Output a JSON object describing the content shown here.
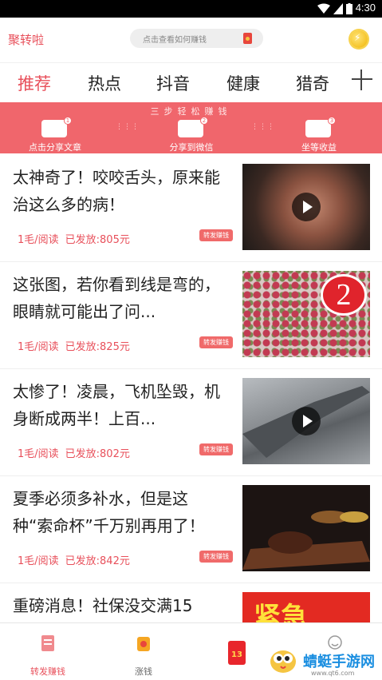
{
  "status_bar": {
    "time": "4:30"
  },
  "header": {
    "brand": "聚转啦",
    "search_placeholder": "点击查看如何赚钱"
  },
  "tabs": [
    {
      "label": "推荐",
      "active": true
    },
    {
      "label": "热点",
      "active": false
    },
    {
      "label": "抖音",
      "active": false
    },
    {
      "label": "健康",
      "active": false
    },
    {
      "label": "猎奇",
      "active": false
    }
  ],
  "banner": {
    "title": "三步轻松赚钱",
    "steps": [
      {
        "num": "1",
        "label": "点击分享文章"
      },
      {
        "num": "2",
        "label": "分享到微信"
      },
      {
        "num": "3",
        "label": "坐等收益"
      }
    ]
  },
  "articles": [
    {
      "title": "太神奇了！咬咬舌头，原来能治这么多的病！",
      "rate": "1毛/阅读",
      "paid": "已发放:805元",
      "tag": "转发赚钱",
      "video": true
    },
    {
      "title": "这张图，若你看到线是弯的，眼睛就可能出了问...",
      "rate": "1毛/阅读",
      "paid": "已发放:825元",
      "tag": "转发赚钱",
      "video": false,
      "badge": "2"
    },
    {
      "title": "太惨了！凌晨，飞机坠毁，机身断成两半！上百...",
      "rate": "1毛/阅读",
      "paid": "已发放:802元",
      "tag": "转发赚钱",
      "video": true
    },
    {
      "title": "夏季必须多补水，但是这种“索命杯”千万别再用了！",
      "rate": "1毛/阅读",
      "paid": "已发放:842元",
      "tag": "转发赚钱",
      "video": false
    },
    {
      "title": "重磅消息！社保没交满15",
      "thumb_text": "紧急",
      "video": false
    }
  ],
  "bottom_nav": [
    {
      "label": "转发赚钱",
      "active": true,
      "icon": "doc-icon"
    },
    {
      "label": "涨钱",
      "active": false,
      "icon": "money-bag-icon"
    },
    {
      "label": "",
      "active": false,
      "icon": "red-envelope-icon",
      "badge": "13"
    },
    {
      "label": "",
      "active": false,
      "icon": "profile-icon"
    }
  ],
  "watermark": {
    "text": "蜻蜓手游网",
    "url": "www.qt6.com"
  },
  "colors": {
    "accent": "#e8505b",
    "banner": "#f0666c"
  }
}
